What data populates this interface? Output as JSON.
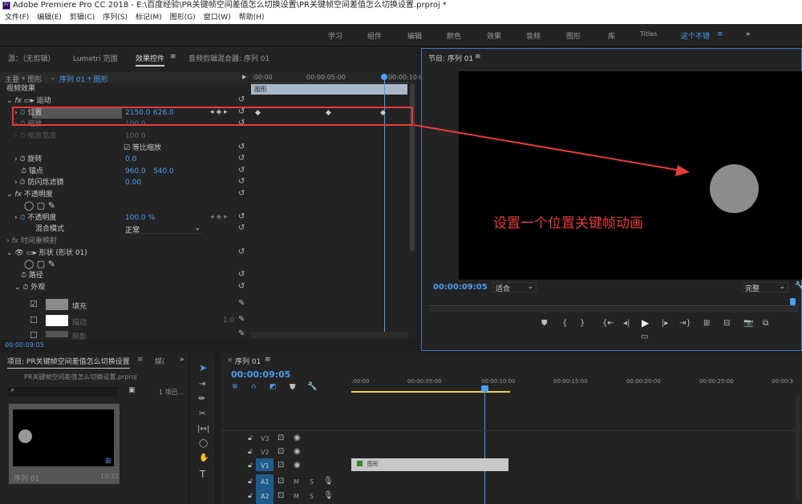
{
  "window": {
    "title": "Adobe Premiere Pro CC 2018 - E:\\百度经验\\PR关键帧空间差值怎么切换设置\\PR关键帧空间差值怎么切换设置.prproj *",
    "logo": "Pr"
  },
  "menu": [
    "文件(F)",
    "编辑(E)",
    "剪辑(C)",
    "序列(S)",
    "标记(M)",
    "图形(G)",
    "窗口(W)",
    "帮助(H)"
  ],
  "workspaces": [
    "学习",
    "组件",
    "编辑",
    "颜色",
    "效果",
    "音频",
    "图形",
    "库",
    "Titles",
    "这个不错"
  ],
  "workspace_active": "这个不错",
  "effects_panel": {
    "tabs": [
      "源：（无剪辑）",
      "Lumetri 范围",
      "效果控件",
      "音频剪辑混合器: 序列 01"
    ],
    "active_tab": "效果控件",
    "master": "主要 * 图形",
    "clip": "序列 01 * 图形",
    "ruler": [
      ":00:00",
      "00:00:05:00",
      "00:00:10:0"
    ],
    "clip_bar": "图形",
    "rows": {
      "video_effects": "视频效果",
      "motion": "运动",
      "position": "位置",
      "position_x": "2150.0",
      "position_y": "626.0",
      "scale": "缩放",
      "scale_val": "100.0",
      "scale_width": "缩放宽度",
      "scale_width_val": "100.0",
      "uniform": "等比缩放",
      "rotation": "旋转",
      "rotation_val": "0.0",
      "anchor": "锚点",
      "anchor_x": "960.0",
      "anchor_y": "540.0",
      "flicker": "防闪烁滤镜",
      "flicker_val": "0.00",
      "opacity_group": "不透明度",
      "opacity": "不透明度",
      "opacity_val": "100.0 %",
      "blend": "混合模式",
      "blend_val": "正常",
      "time_remap": "时间重映射",
      "shape": "形状 (形状 01)",
      "path": "路径",
      "appearance": "外观",
      "fill": "填充",
      "stroke": "描边",
      "stroke_val": "1.0",
      "shadow": "阴影"
    },
    "timecode": "00:00:09:05"
  },
  "program": {
    "title": "节目: 序列 01",
    "timecode": "00:00:09:05",
    "zoom": "适合",
    "quality": "完整",
    "annotation": "设置一个位置关键帧动画"
  },
  "project": {
    "title": "项目: PR关键帧空间差值怎么切换设置",
    "tab2": "媒(",
    "file": "PR关键帧空间差值怎么切换设置.prproj",
    "count": "1 项已...",
    "item_name": "序列 01",
    "item_duration": "10:22"
  },
  "timeline": {
    "title": "序列 01",
    "timecode": "00:00:09:05",
    "ruler": [
      ":00:00",
      "00:00:05:00",
      "00:00:10:00",
      "00:00:15:00",
      "00:00:20:00",
      "00:00:25:00",
      "00:00:3"
    ],
    "tracks": [
      "V3",
      "V2",
      "V1",
      "A1",
      "A2"
    ],
    "clip": "图形",
    "m": "M",
    "s": "S"
  },
  "colors": {
    "accent": "#4a9df0",
    "annotation": "#e83a3a",
    "panel": "#232323"
  }
}
